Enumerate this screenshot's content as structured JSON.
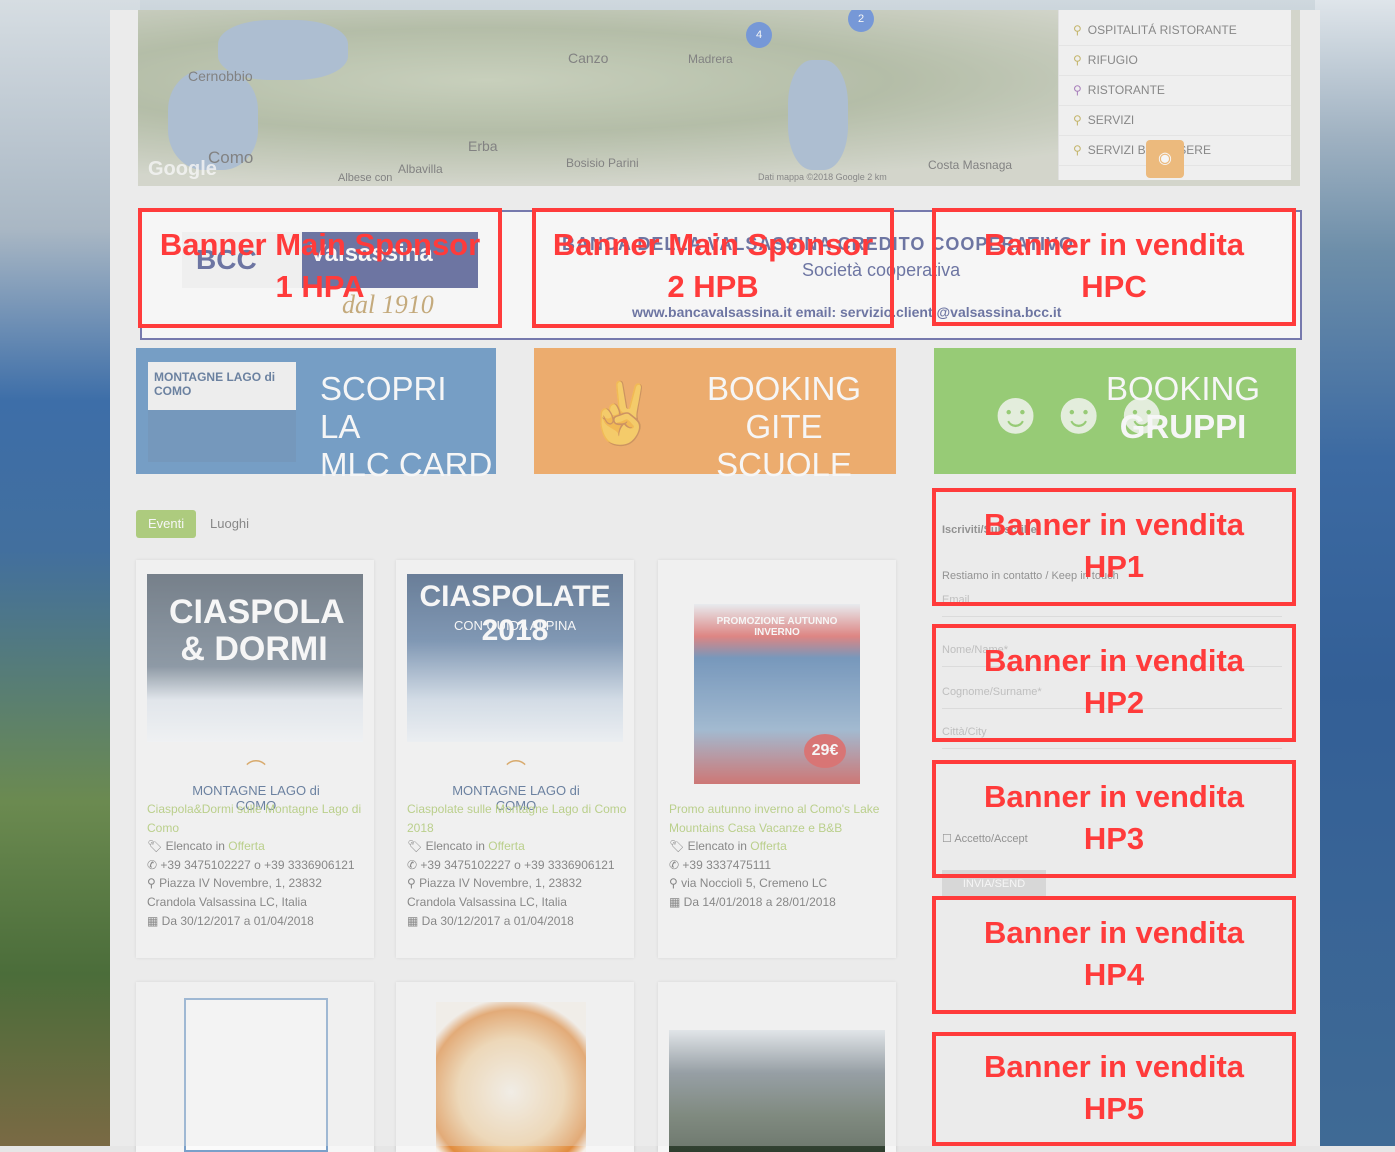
{
  "map": {
    "labels": [
      "Canzo",
      "Cernobbio",
      "Erba",
      "Como",
      "Bosisio Parini",
      "Albavilla",
      "Costa Masnaga",
      "Albese con",
      "Madrera"
    ],
    "google": "Google",
    "credit": "Dati mappa ©2018 Google   2 km",
    "clusters": [
      "4",
      "2"
    ],
    "poi": [
      "OSPITALITÁ RISTORANTE",
      "RIFUGIO",
      "RISTORANTE",
      "SERVIZI",
      "SERVIZI BENESSERE"
    ]
  },
  "sponsor": {
    "bcc_left": "BCC",
    "bcc_right": "Valsassina",
    "dal": "dal 1910",
    "bank_name": "BANCA DELLA VALSASSINA CREDITO COOPERATIVO",
    "bank_sub": "Società cooperativa",
    "bank_url": "www.bancavalsassina.it   email: servizio.clienti@valsassina.bcc.it"
  },
  "banners": {
    "hpa": "Banner Main Sponsor 1 HPA",
    "hpb": "Banner Main Sponsor 2 HPB",
    "hpc": "Banner in vendita HPC",
    "hp1": "Banner in vendita HP1",
    "hp2": "Banner in vendita HP2",
    "hp3": "Banner in vendita HP3",
    "hp4": "Banner in vendita HP4",
    "hp5": "Banner in vendita HP5"
  },
  "tiles": {
    "mlc_logo": "MONTAGNE LAGO di COMO",
    "mlc_line1": "SCOPRI LA",
    "mlc_line2": "MLC CARD",
    "scuole_line1": "BOOKING",
    "scuole_line2": "GITE SCUOLE",
    "gruppi_line1": "BOOKING",
    "gruppi_line2": "GRUPPI"
  },
  "tabs": {
    "active": "Eventi",
    "inactive": "Luoghi"
  },
  "cards": [
    {
      "img_title": "CIASPOLA & DORMI",
      "logo": "MONTAGNE LAGO di COMO",
      "title": "Ciaspola&Dormi sulle Montagne Lago di Como",
      "listed": "Elencato in",
      "category": "Offerta",
      "phone": "+39 3475102227 o +39 3336906121",
      "address": "Piazza IV Novembre, 1, 23832 Crandola Valsassina LC, Italia",
      "dates": "Da 30/12/2017 a 01/04/2018"
    },
    {
      "img_title": "CIASPOLATE 2018",
      "img_sub": "CON GUIDA ALPINA",
      "logo": "MONTAGNE LAGO di COMO",
      "title": "Ciaspolate sulle Montagne Lago di Como 2018",
      "listed": "Elencato in",
      "category": "Offerta",
      "phone": "+39 3475102227 o +39 3336906121",
      "address": "Piazza IV Novembre, 1, 23832 Crandola Valsassina LC, Italia",
      "dates": "Da 30/12/2017 a 01/04/2018"
    },
    {
      "img_title": "PROMOZIONE AUTUNNO INVERNO",
      "img_price": "29€",
      "title": "Promo autunno inverno al Como's Lake Mountains Casa Vacanze e B&B",
      "listed": "Elencato in",
      "category": "Offerta",
      "phone": "+39 3337475111",
      "address": "via Nocciolì 5, Cremeno LC",
      "dates": "Da 14/01/2018 a 28/01/2018"
    }
  ],
  "form": {
    "title": "Iscriviti/Subscribe",
    "line": "Restiamo in contatto / Keep in touch",
    "email": "Email",
    "name": "Nome/Name*",
    "surname": "Cognome/Surname*",
    "city": "Città/City",
    "privacy": "Accetto/Accept",
    "button": "INVIA/SEND"
  },
  "colors": {
    "red": "#ff3b3b",
    "blue_tile": "#3b79b4",
    "orange_tile": "#f08e2e",
    "green_tile": "#6ebd3b"
  }
}
